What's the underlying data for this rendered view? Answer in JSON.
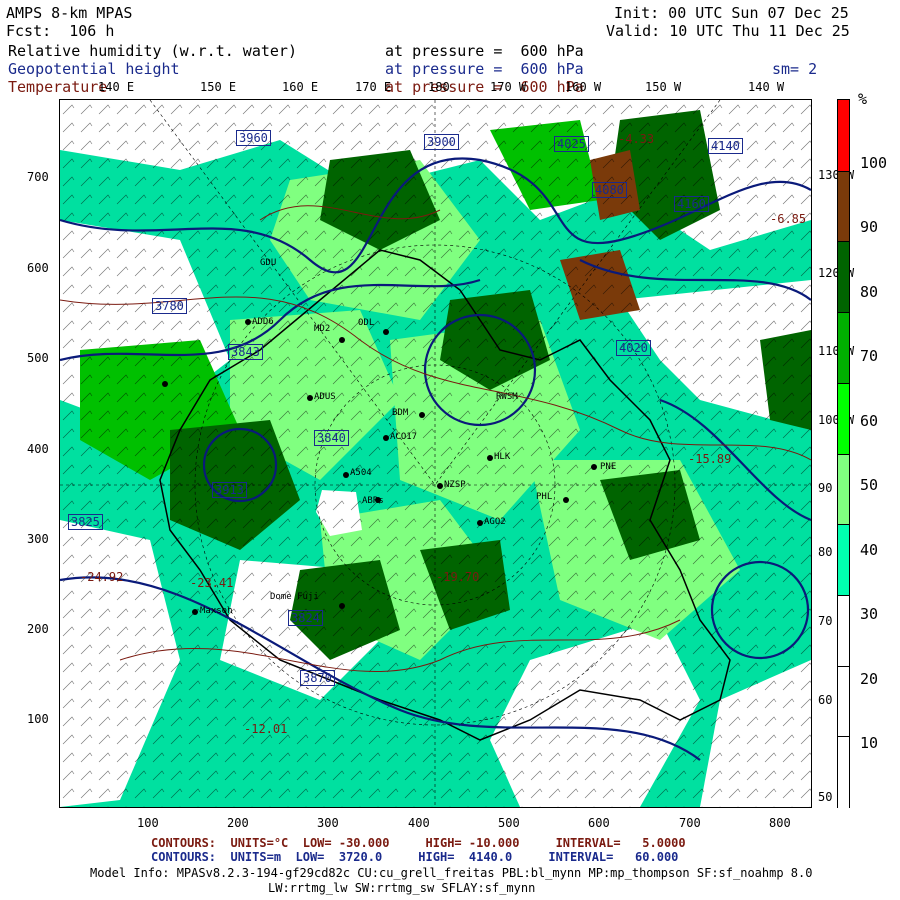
{
  "header": {
    "title": "AMPS 8-km MPAS",
    "fcst": "Fcst:  106 h",
    "init": "Init: 00 UTC Sun 07 Dec 25",
    "valid": "Valid: 10 UTC Thu 11 Dec 25",
    "fields": [
      {
        "name": "Relative humidity (w.r.t. water)",
        "level": "at pressure =  600 hPa",
        "color": "#000000"
      },
      {
        "name": "Geopotential height",
        "level": "at pressure =  600 hPa",
        "color": "#1a2a8c"
      },
      {
        "name": "Temperature",
        "level": "at pressure =  600 hPa",
        "color": "#7a1a10"
      }
    ],
    "smoothing": "sm= 2"
  },
  "axes": {
    "x_ticks": [
      "100",
      "200",
      "300",
      "400",
      "500",
      "600",
      "700",
      "800"
    ],
    "y_ticks": [
      "100",
      "200",
      "300",
      "400",
      "500",
      "600",
      "700"
    ],
    "lon_top": [
      "140 E",
      "150 E",
      "160 E",
      "170 E",
      "180",
      "170 W",
      "160 W",
      "150 W",
      "140 W"
    ],
    "lon_right": [
      "130 W",
      "120 W",
      "110 W",
      "100 W",
      "90 W",
      "80 W",
      "70 W",
      "60 W",
      "50 W"
    ]
  },
  "colorbar": {
    "unit": "%",
    "labels": [
      "100",
      "90",
      "80",
      "70",
      "60",
      "50",
      "40",
      "30",
      "20",
      "10"
    ],
    "colors": [
      "#ff0000",
      "#7a3a0a",
      "#006400",
      "#00b000",
      "#00ff00",
      "#80ff80",
      "#00ffb0",
      "#ffffff",
      "#ffffff",
      "#ffffff"
    ]
  },
  "map_labels": {
    "stations": [
      "GDU",
      "ADD6",
      "MD2",
      "ODL",
      "ADUS",
      "BDM",
      "ACO17",
      "A504",
      "NZSP",
      "ABRs",
      "AGO2",
      "PNE",
      "PHL",
      "HLK",
      "RWSM",
      "Maxson",
      "Dome Fuji"
    ],
    "height_boxes": [
      "3960",
      "3900",
      "3840",
      "3780",
      "3870",
      "3824",
      "3843",
      "3913",
      "3825",
      "4080",
      "4025",
      "4140",
      "4160",
      "4020"
    ],
    "temp_values": [
      "-24.92",
      "-23.41",
      "-12.01",
      "-19.70",
      "-15.89",
      "-4.33",
      "-6.85"
    ]
  },
  "footer": {
    "contours1": "CONTOURS:  UNITS=°C  LOW= -30.000     HIGH= -10.000     INTERVAL=   5.0000",
    "contours2": "CONTOURS:  UNITS=m  LOW=  3720.0     HIGH=  4140.0     INTERVAL=   60.000",
    "model_info": "Model Info: MPASv8.2.3-194-gf29cd82c CU:cu_grell_freitas PBL:bl_mynn MP:mp_thompson SF:sf_noahmp 8.0",
    "model_info2": "LW:rrtmg_lw SW:rrtmg_sw SFLAY:sf_mynn",
    "colors": {
      "contours1": "#7a1a10",
      "contours2": "#1a2a8c"
    }
  }
}
